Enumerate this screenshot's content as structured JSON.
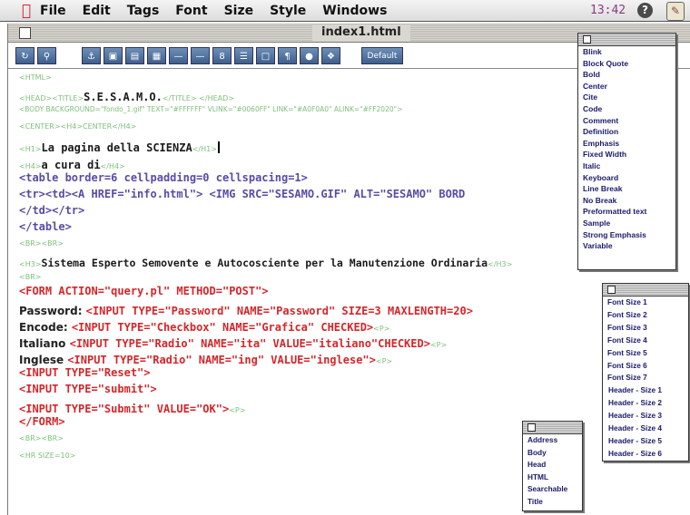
{
  "menubar": {
    "items": [
      "File",
      "Edit",
      "Tags",
      "Font",
      "Size",
      "Style",
      "Windows"
    ],
    "clock": "13:42",
    "help_glyph": "?"
  },
  "window": {
    "title": "index1.html",
    "toolbar": {
      "button_icons": [
        "reload-icon",
        "search-icon",
        "anchor-icon",
        "image-icon",
        "paragraph-icon",
        "list-icon",
        "hr-icon",
        "hr2-icon",
        "number-icon",
        "outline-icon",
        "box-icon",
        "pilcrow-icon",
        "bullet-icon",
        "link-icon"
      ],
      "default_label": "Default"
    }
  },
  "code": {
    "l1": "<HTML>",
    "l2a": "<HEAD><TITLE>",
    "l2b": "S.E.S.A.M.O.",
    "l2c": "</TITLE> </HEAD>",
    "l3": "<BODY BACKGROUND=\"fondo_1.gif\" TEXT=\"#FFFFFF\" VLINK=\"#0060FF\" LINK=\"#A0F0A0\" ALINK=\"#FF2020\">",
    "l4": "<CENTER><H4>CENTER</H4>",
    "l5a": "<H1>",
    "l5b": "La pagina della SCIENZA",
    "l5c": "</H1>",
    "l6a": "<H4>",
    "l6b": "a cura di",
    "l6c": "</H4>",
    "l7": "<table border=6 cellpadding=0 cellspacing=1>",
    "l8": "<tr><td><A HREF=\"info.html\">  <IMG SRC=\"SESAMO.GIF\" ALT=\"SESAMO\" BORD",
    "l9": "</td></tr>",
    "l10": "</table>",
    "l11": "<BR><BR>",
    "l12a": "<H3>",
    "l12b": "Sistema Esperto Semovente e Autocosciente per la Manutenzione Ordinaria",
    "l12c": "</H3>",
    "l13": "<BR>",
    "l14": "<FORM ACTION=\"query.pl\" METHOD=\"POST\">",
    "l15a": "Password: ",
    "l15b": "<INPUT TYPE=\"Password\" NAME=\"Password\" SIZE=3 MAXLENGTH=20>",
    "l16a": " Encode: ",
    "l16b": "<INPUT TYPE=\"Checkbox\" NAME=\"Grafica\" CHECKED>",
    "l16c": "<P>",
    "l17a": "Italiano ",
    "l17b": "<INPUT TYPE=\"Radio\" NAME=\"ita\" VALUE=\"italiano\"CHECKED>",
    "l17c": "<P>",
    "l18a": "Inglese ",
    "l18b": "<INPUT TYPE=\"Radio\" NAME=\"ing\" VALUE=\"inglese\">",
    "l18c": "<P>",
    "l19": "<INPUT TYPE=\"Reset\">",
    "l20": "<INPUT TYPE=\"submit\">",
    "l21a": "<INPUT TYPE=\"Submit\" VALUE=\"OK\">",
    "l21b": "<P>",
    "l22": "</FORM>",
    "l23": "<BR><BR>",
    "l24": "<HR SIZE=10>"
  },
  "palettes": {
    "styles": [
      "Blink",
      "Block Quote",
      "Bold",
      "Center",
      "Cite",
      "Code",
      "Comment",
      "Definition",
      "Emphasis",
      "Fixed Width",
      "Italic",
      "Keyboard",
      "Line Break",
      "No Break",
      "Preformatted text",
      "Sample",
      "Strong Emphasis",
      "Variable"
    ],
    "sizes": [
      "Font Size 1",
      "Font Size 2",
      "Font Size 3",
      "Font Size 4",
      "Font Size 5",
      "Font Size 6",
      "Font Size 7",
      "Header - Size 1",
      "Header - Size 2",
      "Header - Size 3",
      "Header - Size 4",
      "Header - Size 5",
      "Header - Size 6"
    ],
    "document": [
      "Address",
      "Body",
      "Head",
      "HTML",
      "Searchable",
      "Title"
    ]
  }
}
